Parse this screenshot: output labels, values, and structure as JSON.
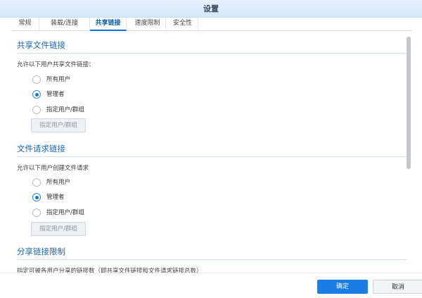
{
  "window": {
    "title": "设置"
  },
  "tabs": [
    {
      "label": "常规",
      "active": false
    },
    {
      "label": "装载/连接",
      "active": false
    },
    {
      "label": "共享链接",
      "active": true
    },
    {
      "label": "速度限制",
      "active": false
    },
    {
      "label": "安全性",
      "active": false
    }
  ],
  "share_links": {
    "title": "共享文件链接",
    "description": "允许以下用户共享文件链接：",
    "options": [
      {
        "label": "所有用户",
        "checked": false
      },
      {
        "label": "管理者",
        "checked": true
      },
      {
        "label": "指定用户/群组",
        "checked": false
      }
    ],
    "specify_button": "指定用户/群组"
  },
  "request_links": {
    "title": "文件请求链接",
    "description": "允许以下用户创建文件请求",
    "options": [
      {
        "label": "所有用户",
        "checked": false
      },
      {
        "label": "管理者",
        "checked": true
      },
      {
        "label": "指定用户/群组",
        "checked": false
      }
    ],
    "specify_button": "指定用户/群组"
  },
  "link_limits": {
    "title": "分享链接限制",
    "description_partial": "指定可被各用户分享的链接数（即共享文件链接和文件请求链接总数）"
  },
  "footer": {
    "primary_label": "确定",
    "secondary_label": "取消"
  },
  "colors": {
    "accent": "#1a73d0",
    "section_title": "#1b66b3",
    "titlebar": "#dcecf9"
  }
}
